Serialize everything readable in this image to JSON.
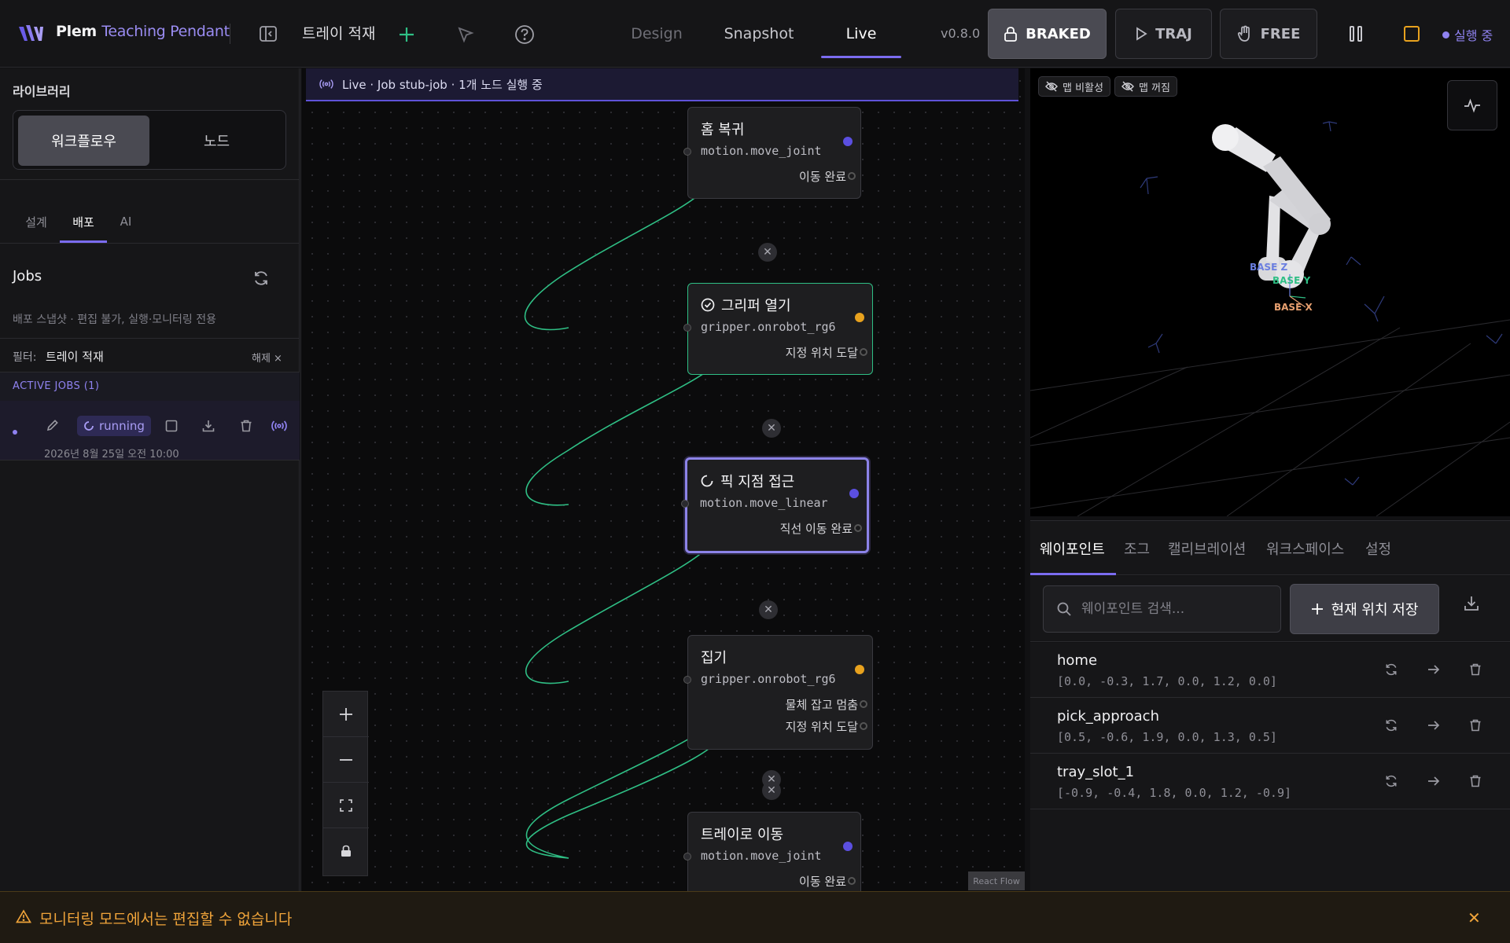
{
  "header": {
    "brand_primary": "Plem",
    "brand_secondary": "Teaching Pendant",
    "project_name": "트레이 적재",
    "modes": [
      "Design",
      "Snapshot",
      "Live"
    ],
    "active_mode": "Live",
    "version": "v0.8.0",
    "state_buttons": {
      "braked": "BRAKED",
      "traj": "TRAJ",
      "free": "FREE"
    },
    "status": "실행 중",
    "accent_color": "#7b6cf0"
  },
  "sidebar": {
    "library_title": "라이브러리",
    "segment": {
      "workflow": "워크플로우",
      "node": "노드"
    },
    "subtabs": {
      "design": "설계",
      "deploy": "배포",
      "ai": "AI"
    },
    "jobs_title": "Jobs",
    "jobs_subtitle": "배포 스냅샷 · 편집 불가, 실행·모니터링 전용",
    "filter": {
      "label": "필터:",
      "value": "트레이 적재",
      "clear": "해제 ×"
    },
    "active_jobs_header": "ACTIVE JOBS (1)",
    "job": {
      "status": "running",
      "date": "2026년 8월 25일 오전 10:00"
    }
  },
  "canvas": {
    "banner": "Live · Job stub-job · 1개 노드 실행 중",
    "nodes": [
      {
        "title": "홈 복귀",
        "type": "motion.move_joint",
        "outputs": [
          "이동 완료"
        ],
        "status": "idle"
      },
      {
        "title": "그리퍼 열기",
        "type": "gripper.onrobot_rg6",
        "outputs": [
          "지정 위치 도달"
        ],
        "status": "done"
      },
      {
        "title": "픽 지점 접근",
        "type": "motion.move_linear",
        "outputs": [
          "직선 이동 완료"
        ],
        "status": "running"
      },
      {
        "title": "집기",
        "type": "gripper.onrobot_rg6",
        "outputs": [
          "물체 잡고 멈춤",
          "지정 위치 도달"
        ],
        "status": "idle"
      },
      {
        "title": "트레이로 이동",
        "type": "motion.move_joint",
        "outputs": [
          "이동 완료"
        ],
        "status": "idle"
      }
    ],
    "attribution": "React Flow",
    "edge_color": "#2fbf85",
    "motion_handle_color": "#5b4fe0",
    "gripper_handle_color": "#e8a21e"
  },
  "viewport": {
    "chip_map_inactive": "맵 비활성",
    "chip_map_off": "맵 꺼짐",
    "axis_labels": {
      "z": "BASE Z",
      "y": "BASE Y",
      "x": "BASE X"
    }
  },
  "right_tabs": [
    "웨이포인트",
    "조그",
    "캘리브레이션",
    "워크스페이스",
    "설정"
  ],
  "waypoints": {
    "search_placeholder": "웨이포인트 검색...",
    "save_label": "현재 위치 저장",
    "items": [
      {
        "name": "home",
        "values": "[0.0, -0.3, 1.7, 0.0, 1.2, 0.0]"
      },
      {
        "name": "pick_approach",
        "values": "[0.5, -0.6, 1.9, 0.0, 1.3, 0.5]"
      },
      {
        "name": "tray_slot_1",
        "values": "[-0.9, -0.4, 1.8, 0.0, 1.2, -0.9]"
      }
    ]
  },
  "toast": {
    "message": "모니터링 모드에서는 편집할 수 없습니다"
  }
}
